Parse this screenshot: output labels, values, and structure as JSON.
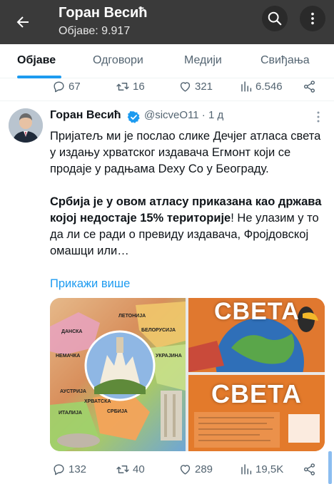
{
  "header": {
    "title": "Горан Весић",
    "posts_label": "Објаве: 9.917"
  },
  "tabs": [
    {
      "label": "Објаве",
      "active": true
    },
    {
      "label": "Одговори",
      "active": false
    },
    {
      "label": "Медији",
      "active": false
    },
    {
      "label": "Свиђања",
      "active": false
    }
  ],
  "prev_tweet_actions": {
    "replies": "67",
    "reposts": "16",
    "likes": "321",
    "views": "6.546"
  },
  "tweet": {
    "author_name": "Горан Весић",
    "handle_time": "@sicveO11 · 1 д",
    "text_p1": "Пријатељ ми је послао слике Дечјег атласа света у издању хрватског издавача Егмонт који се продаје у радњама Dexy Co у Београду.",
    "text_bold": "Србија је у овом атласу приказана као држава којој недостаје 15% територије",
    "text_rest": "! Не улазим у то да ли се ради о превиду издавача, Фројдовској омашци или…",
    "show_more": "Прикажи више",
    "media": {
      "map_labels": [
        "ЛЕТОНИЈА",
        "ДАНСКА",
        "БЕЛОРУСИЈА",
        "НЕМАЧКА",
        "УКРАЈИНА",
        "АУСТРИЈА",
        "ХРВАТСКА",
        "ИТАЛИЈА",
        "СРБИЈА"
      ],
      "book_word": "СВЕТА"
    },
    "actions": {
      "replies": "132",
      "reposts": "40",
      "likes": "289",
      "views": "19,5K"
    }
  },
  "colors": {
    "accent": "#1d9bf0",
    "header_bg": "#3a3a3a",
    "muted": "#536471"
  }
}
